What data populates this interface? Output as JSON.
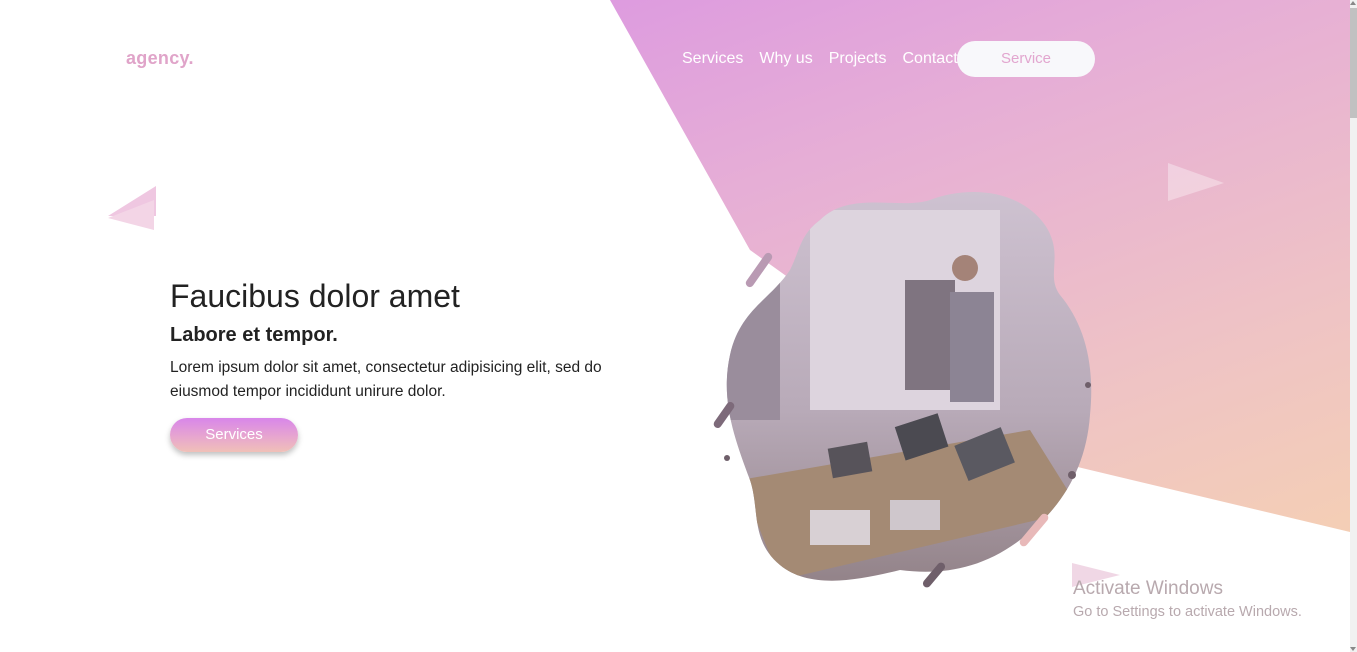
{
  "logo": "agency.",
  "nav": {
    "items": [
      "Services",
      "Why us",
      "Projects",
      "Contact"
    ],
    "button": "Service"
  },
  "hero": {
    "title": "Faucibus dolor amet",
    "subtitle": "Labore et tempor.",
    "description": "Lorem ipsum dolor sit amet, consectetur adipisicing elit, sed do eiusmod tempor incididunt unirure dolor.",
    "cta": "Services"
  },
  "watermark": {
    "line1": "Activate Windows",
    "line2": "Go to Settings to activate Windows."
  },
  "colors": {
    "accent_pink": "#e0a4c9",
    "gradient_start": "#d58ae8",
    "gradient_end": "#f7d4ad"
  }
}
